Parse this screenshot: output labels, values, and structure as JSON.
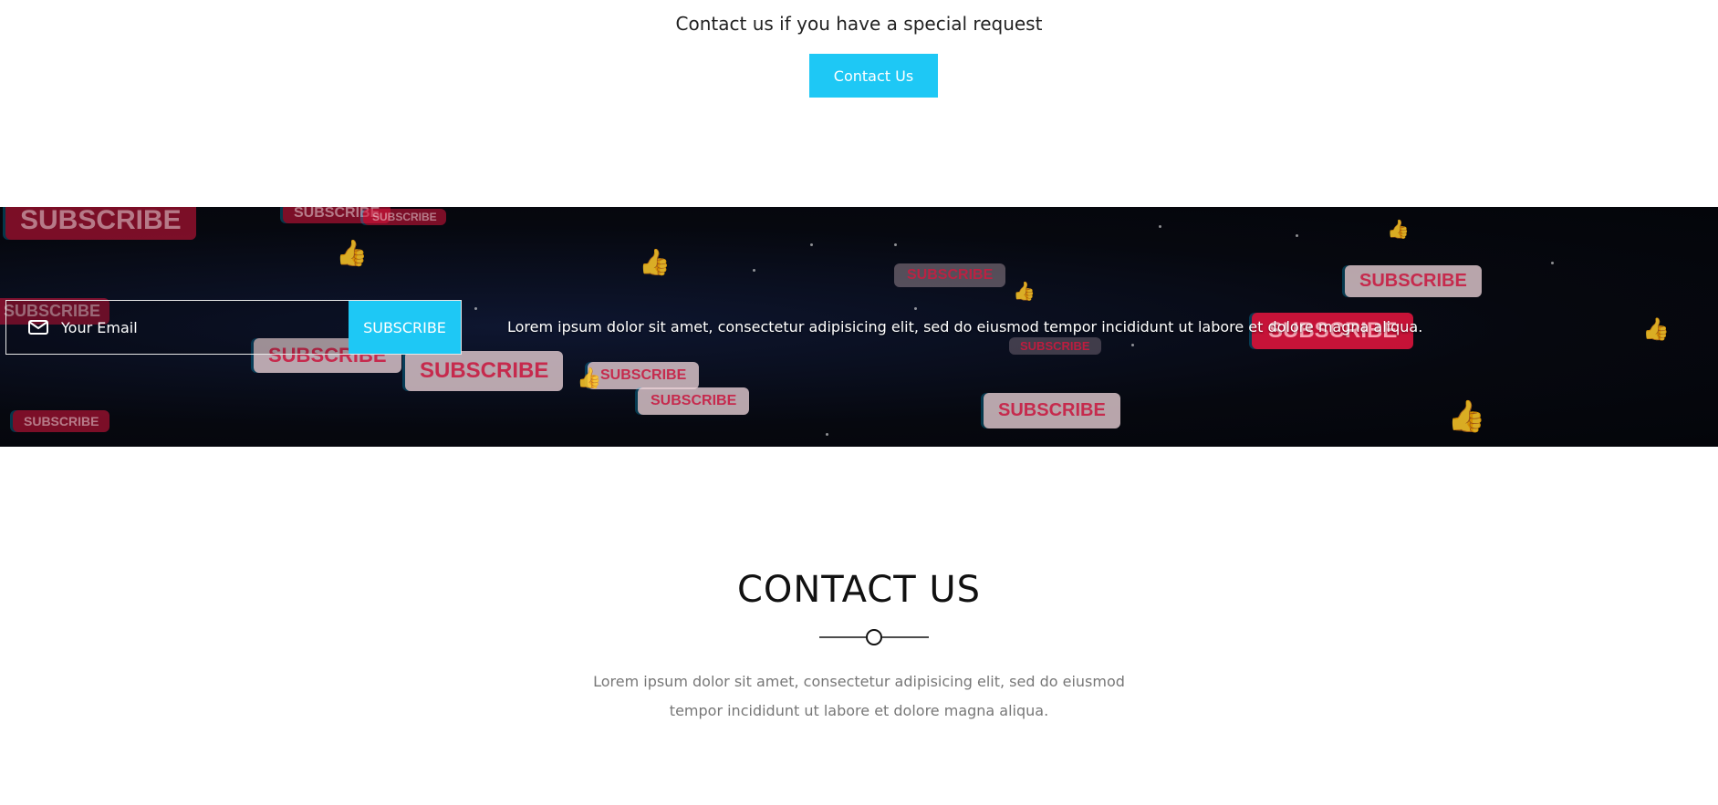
{
  "special_request": {
    "text": "Contact us if you have a special request",
    "button_label": "Contact Us"
  },
  "subscribe": {
    "email_placeholder": "Your Email",
    "button_label": "SUBSCRIBE",
    "description": "Lorem ipsum dolor sit amet, consectetur adipisicing elit, sed do eiusmod tempor incididunt ut labore et dolore magna aliqua.",
    "background_word": "SUBSCRIBE"
  },
  "contact": {
    "title": "CONTACT US",
    "description": "Lorem ipsum dolor sit amet, consectetur adipisicing elit, sed do eiusmod tempor incididunt ut labore et dolore magna aliqua."
  },
  "colors": {
    "accent": "#1ec8f5",
    "banner_bg": "#06080f",
    "subscribe_red": "#dc143c",
    "thumb_blue": "#466ee6"
  },
  "icons": {
    "mail": "mail-icon",
    "thumbs_up": "thumbs-up-icon",
    "divider": "circle-divider-icon"
  }
}
